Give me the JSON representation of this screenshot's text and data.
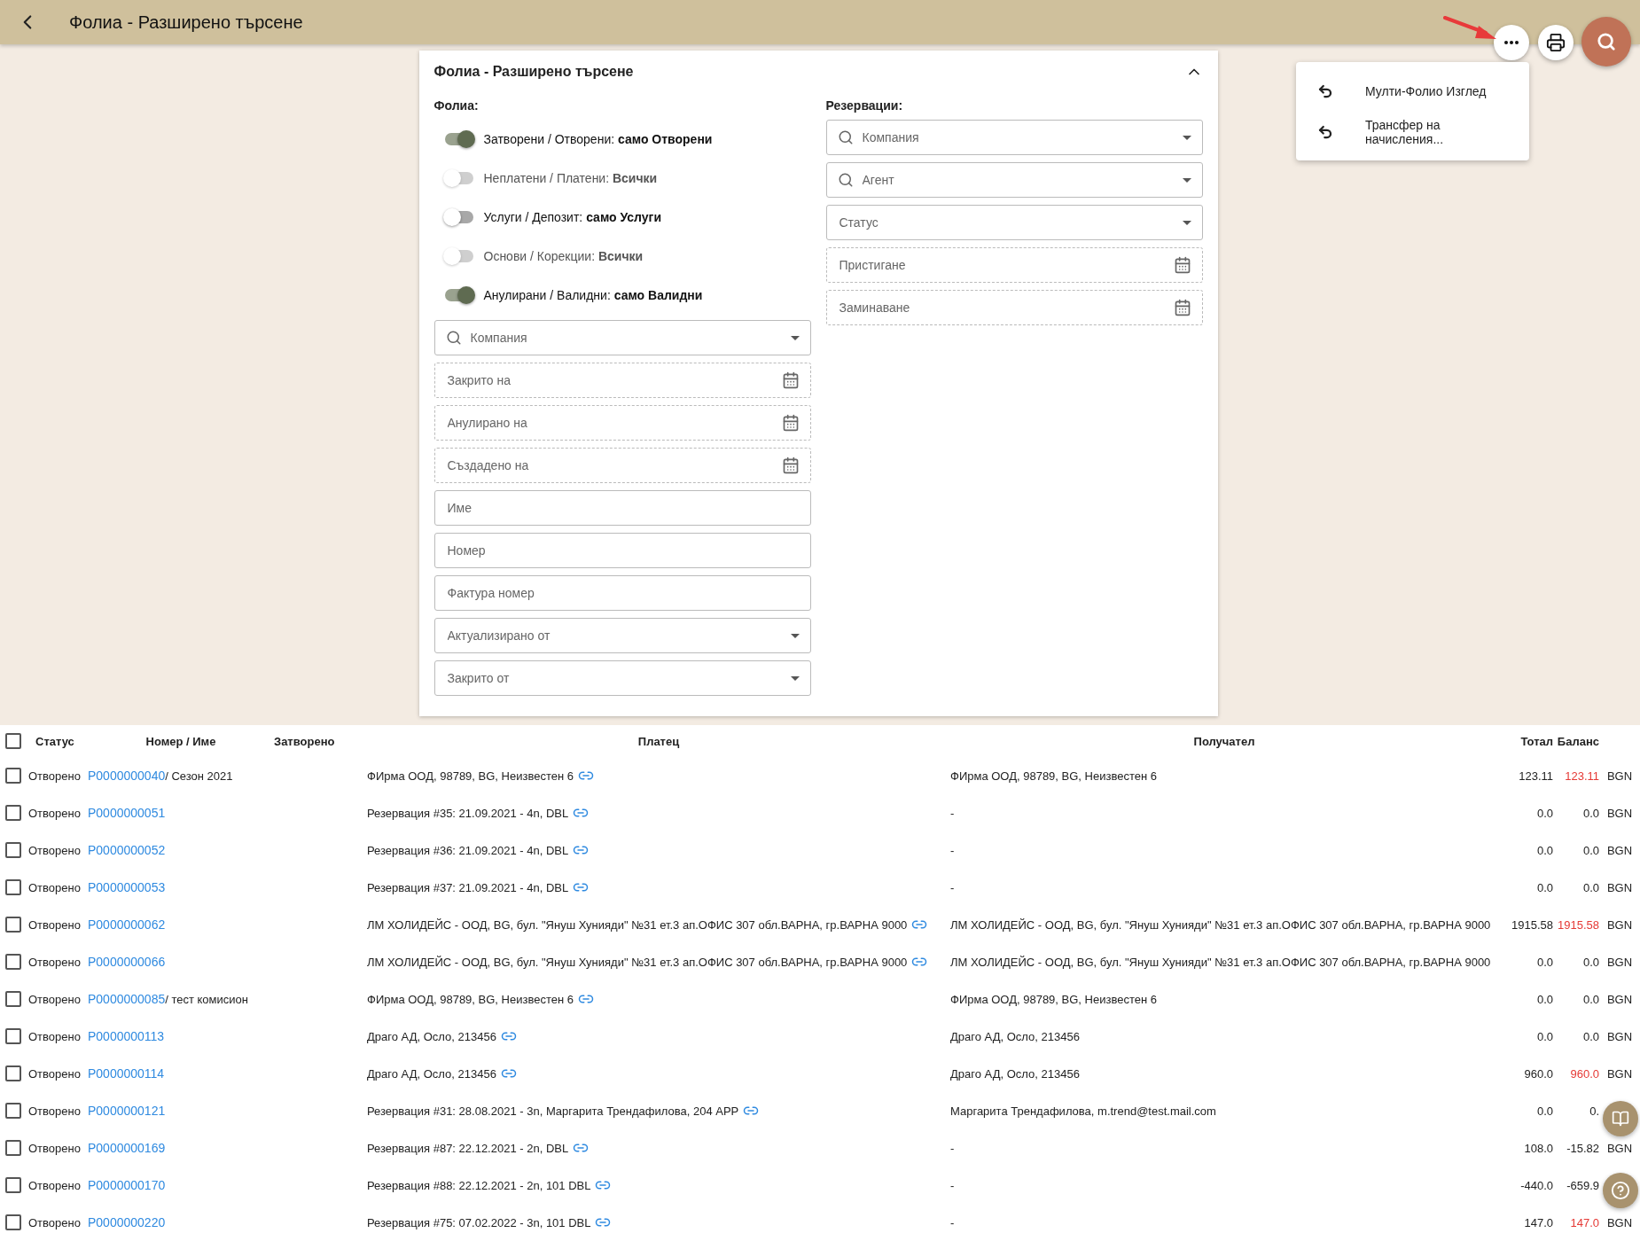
{
  "header": {
    "title": "Фолиа - Разширено търсене"
  },
  "menu": [
    {
      "label": "Мулти-Фолио Изглед"
    },
    {
      "label": "Трансфер на начисления..."
    }
  ],
  "panel": {
    "title": "Фолиа - Разширено търсене",
    "expanded": true,
    "left_heading": "Фолиа:",
    "toggles": [
      {
        "label": "Затворени / Отворени: **само Отворени**",
        "on": true,
        "disabled": false
      },
      {
        "label": "Неплатени / Платени: **Всички**",
        "on": false,
        "disabled": true
      },
      {
        "label": "Услуги / Депозит: **само Услуги**",
        "on": false,
        "disabled": false
      },
      {
        "label": "Основи / Корекции: **Всички**",
        "on": false,
        "disabled": true
      },
      {
        "label": "Анулирани / Валидни: **само Валидни**",
        "on": true,
        "disabled": false
      }
    ],
    "left_fields": [
      {
        "kind": "search-select",
        "placeholder": "Компания"
      },
      {
        "kind": "date",
        "placeholder": "Закрито на"
      },
      {
        "kind": "date",
        "placeholder": "Анулирано на"
      },
      {
        "kind": "date",
        "placeholder": "Създадено на"
      },
      {
        "kind": "text",
        "placeholder": "Име"
      },
      {
        "kind": "text",
        "placeholder": "Номер"
      },
      {
        "kind": "text",
        "placeholder": "Фактура номер"
      },
      {
        "kind": "select",
        "placeholder": "Актуализирано от"
      },
      {
        "kind": "select",
        "placeholder": "Закрито от"
      }
    ],
    "right_heading": "Резервации:",
    "right_fields": [
      {
        "kind": "search-select",
        "placeholder": "Компания"
      },
      {
        "kind": "search-select",
        "placeholder": "Агент"
      },
      {
        "kind": "select",
        "placeholder": "Статус"
      },
      {
        "kind": "date",
        "placeholder": "Пристигане"
      },
      {
        "kind": "date",
        "placeholder": "Заминаване"
      }
    ]
  },
  "table": {
    "all_checked": false,
    "columns": [
      "Статус",
      "Номер / Име",
      "Затворено",
      "Платец",
      "Получател",
      "Тотал",
      "Баланс"
    ],
    "rows": [
      {
        "checked": false,
        "status": "Отворено",
        "number": "P0000000040",
        "name": " / Сезон 2021",
        "payer": "ФИрма ООД, 98789, BG, Неизвестен 6",
        "receiver": "ФИрма ООД, 98789, BG, Неизвестен 6",
        "total": "123.11",
        "balance": "123.11",
        "alert": true,
        "currency": "BGN"
      },
      {
        "checked": false,
        "status": "Отворено",
        "number": "P0000000051",
        "payer": "Резервация #35: 21.09.2021 - 4n, DBL",
        "receiver": "-",
        "total": "0.0",
        "balance": "0.0",
        "alert": false,
        "currency": "BGN"
      },
      {
        "checked": false,
        "status": "Отворено",
        "number": "P0000000052",
        "payer": "Резервация #36: 21.09.2021 - 4n, DBL",
        "receiver": "-",
        "total": "0.0",
        "balance": "0.0",
        "alert": false,
        "currency": "BGN"
      },
      {
        "checked": false,
        "status": "Отворено",
        "number": "P0000000053",
        "payer": "Резервация #37: 21.09.2021 - 4n, DBL",
        "receiver": "-",
        "total": "0.0",
        "balance": "0.0",
        "alert": false,
        "currency": "BGN"
      },
      {
        "checked": false,
        "status": "Отворено",
        "number": "P0000000062",
        "payer": "ЛМ ХОЛИДЕЙС - ООД, BG, бул. \"Януш Хунияди\" №31 ет.3 ап.ОФИС 307 обл.ВАРНА, гр.ВАРНА 9000",
        "receiver": "ЛМ ХОЛИДЕЙС - ООД, BG, бул. \"Януш Хунияди\" №31 ет.3 ап.ОФИС 307 обл.ВАРНА, гр.ВАРНА 9000",
        "total": "1915.58",
        "balance": "1915.58",
        "alert": true,
        "currency": "BGN"
      },
      {
        "checked": false,
        "status": "Отворено",
        "number": "P0000000066",
        "payer": "ЛМ ХОЛИДЕЙС - ООД, BG, бул. \"Януш Хунияди\" №31 ет.3 ап.ОФИС 307 обл.ВАРНА, гр.ВАРНА 9000",
        "receiver": "ЛМ ХОЛИДЕЙС - ООД, BG, бул. \"Януш Хунияди\" №31 ет.3 ап.ОФИС 307 обл.ВАРНА, гр.ВАРНА 9000",
        "total": "0.0",
        "balance": "0.0",
        "alert": false,
        "currency": "BGN"
      },
      {
        "checked": false,
        "status": "Отворено",
        "number": "P0000000085",
        "name": " / тест комисион",
        "payer": "ФИрма ООД, 98789, BG, Неизвестен 6",
        "receiver": "ФИрма ООД, 98789, BG, Неизвестен 6",
        "total": "0.0",
        "balance": "0.0",
        "alert": false,
        "currency": "BGN"
      },
      {
        "checked": false,
        "status": "Отворено",
        "number": "P0000000113",
        "payer": "Драго АД, Осло, 213456",
        "receiver": "Драго АД, Осло, 213456",
        "total": "0.0",
        "balance": "0.0",
        "alert": false,
        "currency": "BGN"
      },
      {
        "checked": false,
        "status": "Отворено",
        "number": "P0000000114",
        "payer": "Драго АД, Осло, 213456",
        "receiver": "Драго АД, Осло, 213456",
        "total": "960.0",
        "balance": "960.0",
        "alert": true,
        "currency": "BGN"
      },
      {
        "checked": false,
        "status": "Отворено",
        "number": "P0000000121",
        "payer": "Резервация #31: 28.08.2021 - 3n, Маргарита Трендафилова, 204 APP",
        "receiver": "Маргарита Трендафилова, m.trend@test.mail.com",
        "total": "0.0",
        "balance": "0.",
        "alert": false
      },
      {
        "checked": false,
        "status": "Отворено",
        "number": "P0000000169",
        "payer": "Резервация #87: 22.12.2021 - 2n, DBL",
        "receiver": "-",
        "total": "108.0",
        "balance": "-15.82",
        "alert": false,
        "currency": "BGN"
      },
      {
        "checked": false,
        "status": "Отворено",
        "number": "P0000000170",
        "payer": "Резервация #88: 22.12.2021 - 2n, 101 DBL",
        "receiver": "-",
        "total": "-440.0",
        "balance": "-659.9",
        "alert": false
      },
      {
        "checked": false,
        "status": "Отворено",
        "number": "P0000000220",
        "payer": "Резервация #75: 07.02.2022 - 3n, 101 DBL",
        "receiver": "-",
        "total": "147.0",
        "balance": "147.0",
        "alert": true,
        "currency": "BGN"
      }
    ]
  }
}
